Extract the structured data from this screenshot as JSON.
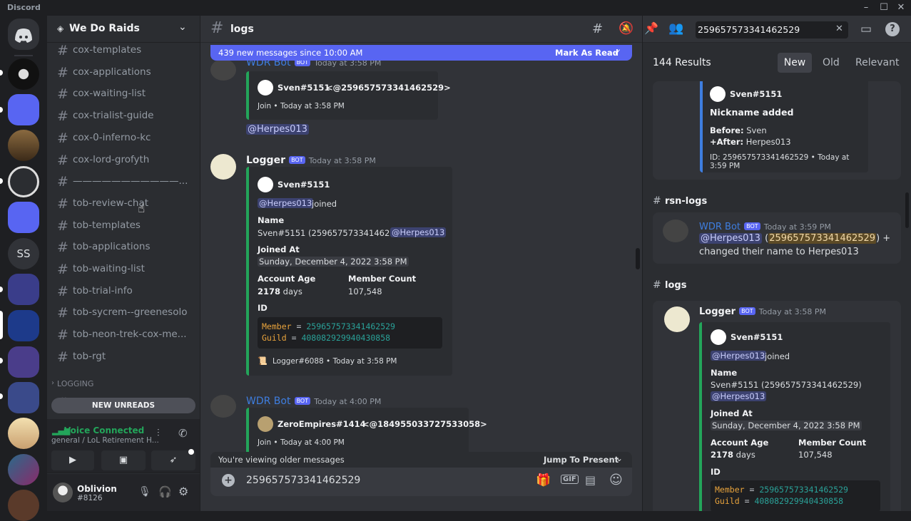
{
  "window": {
    "app_name": "Discord",
    "minimize": "–",
    "maximize": "☐",
    "close": "✕"
  },
  "guild": {
    "name": "We Do Raids",
    "initials_ss": "SS"
  },
  "channels": [
    {
      "name": "cox-templates"
    },
    {
      "name": "cox-applications"
    },
    {
      "name": "cox-waiting-list"
    },
    {
      "name": "cox-trialist-guide"
    },
    {
      "name": "cox-0-inferno-kc"
    },
    {
      "name": "cox-lord-grofyth"
    },
    {
      "name": "———————————..."
    },
    {
      "name": "tob-review-chat"
    },
    {
      "name": "tob-templates"
    },
    {
      "name": "tob-applications"
    },
    {
      "name": "tob-waiting-list"
    },
    {
      "name": "tob-trial-info"
    },
    {
      "name": "tob-sycrem--greenesolo"
    },
    {
      "name": "tob-neon-trek-cox-me..."
    },
    {
      "name": "tob-rgt"
    }
  ],
  "category_logging": "LOGGING",
  "logs_channel": "logs",
  "new_unreads": "NEW UNREADS",
  "voice": {
    "status": "Voice Connected",
    "location": "general / LoL Retirement H..."
  },
  "user": {
    "name": "Oblivion",
    "tag": "#8126"
  },
  "chat": {
    "channel": "logs",
    "banner": "439 new messages since 10:00 AM",
    "mark_read": "Mark As Read",
    "older_notice": "You're viewing older messages",
    "jump_present": "Jump To Present",
    "composer_value": "259657573341462529",
    "gif": "GIF"
  },
  "msg1": {
    "author": "WDR Bot",
    "bot": "BOT",
    "time": "Today at 3:58 PM",
    "embed_user": "Sven#5151",
    "embed_mention": "<@259657573341462529>",
    "embed_footer": "Join • Today at 3:58 PM",
    "mention": "@Herpes013"
  },
  "msg2": {
    "author": "Logger",
    "bot": "BOT",
    "time": "Today at 3:58 PM",
    "embed_user": "Sven#5151",
    "mention": "@Herpes013",
    "joined": "joined",
    "name_label": "Name",
    "name_value": "Sven#5151 (259657573341462529)",
    "joined_label": "Joined At",
    "joined_value": "Sunday, December 4, 2022 3:58 PM",
    "age_label": "Account Age",
    "age_num": "2178",
    "age_unit": "days",
    "count_label": "Member Count",
    "count_value": "107,548",
    "id_label": "ID",
    "code_member": "Member",
    "code_member_val": "259657573341462529",
    "code_guild": "Guild",
    "code_guild_val": "408082929940430858",
    "eq": "=",
    "footer": "Logger#6088 • Today at 3:58 PM"
  },
  "msg3": {
    "author": "WDR Bot",
    "bot": "BOT",
    "time": "Today at 4:00 PM",
    "embed_user": "ZeroEmpires#1414",
    "embed_mention": "<@184955033727533058>",
    "embed_footer": "Join • Today at 4:00 PM"
  },
  "search": {
    "query": "259657573341462529",
    "results": "144 Results",
    "tab_new": "New",
    "tab_old": "Old",
    "tab_relevant": "Relevant"
  },
  "sr1": {
    "user": "Sven#5151",
    "title": "Nickname added",
    "before_label": "Before:",
    "before_val": "Sven",
    "after_label": "+After:",
    "after_val": "Herpes013",
    "footer": "ID: 259657573341462529 • Today at 3:59 PM"
  },
  "sr2": {
    "channel": "rsn-logs",
    "author": "WDR Bot",
    "bot": "BOT",
    "time": "Today at 3:59 PM",
    "mention": "@Herpes013",
    "id": "259657573341462529",
    "tail1": ") +",
    "tail2": "changed their name to Herpes013",
    "open": "("
  },
  "sr3": {
    "channel": "logs",
    "author": "Logger",
    "bot": "BOT",
    "time": "Today at 3:58 PM",
    "user": "Sven#5151",
    "mention": "@Herpes013",
    "joined": "joined",
    "name_label": "Name",
    "name_value": "Sven#5151 (259657573341462529)",
    "joined_label": "Joined At",
    "joined_value": "Sunday, December 4, 2022 3:58 PM",
    "age_label": "Account Age",
    "age_num": "2178",
    "age_unit": "days",
    "count_label": "Member Count",
    "count_value": "107,548",
    "id_label": "ID",
    "code_member": "Member",
    "code_member_val": "259657573341462529",
    "code_guild": "Guild",
    "code_guild_val": "408082929940430858",
    "eq": "="
  },
  "colors": {
    "accent": "#5865f2",
    "green": "#23a55a",
    "bg": "#313338"
  }
}
